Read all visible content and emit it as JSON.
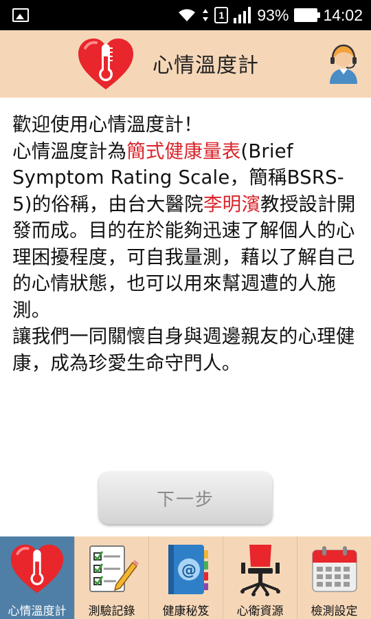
{
  "status_bar": {
    "battery": "93%",
    "time": "14:02",
    "sim": "1",
    "icons": [
      "image-icon",
      "wifi-icon",
      "sim-icon",
      "signal-icon",
      "battery-icon"
    ]
  },
  "header": {
    "title": "心情溫度計",
    "logo_icon": "heart-thermometer-icon",
    "support_icon": "customer-support-icon"
  },
  "intro": {
    "p1": "歡迎使用心情溫度計！",
    "p2_a": "心情溫度計為",
    "p2_red": "簡式健康量表",
    "p2_b": "(Brief Symptom Rating Scale，簡稱BSRS-5)的俗稱，由台大醫院",
    "p2_red2": "李明濱",
    "p2_c": "教授設計開發而成。目的在於能夠迅速了解個人的心理困擾程度，可自我量測，藉以了解自己的心情狀態，也可以用來幫週遭的人施測。",
    "p3": "讓我們一同關懷自身與週邊親友的心理健康，成為珍愛生命守門人。"
  },
  "next_button": {
    "label": "下一步"
  },
  "nav": [
    {
      "label": "心情溫度計",
      "icon": "heart-thermometer-icon",
      "active": true
    },
    {
      "label": "測驗記錄",
      "icon": "checklist-icon",
      "active": false
    },
    {
      "label": "健康秘笈",
      "icon": "address-book-icon",
      "active": false
    },
    {
      "label": "心衛資源",
      "icon": "office-chair-icon",
      "active": false
    },
    {
      "label": "檢測設定",
      "icon": "calendar-icon",
      "active": false
    }
  ],
  "colors": {
    "header_bg": "#f5d7b8",
    "active_tab": "#4f7fa6",
    "highlight": "#d9232a"
  }
}
